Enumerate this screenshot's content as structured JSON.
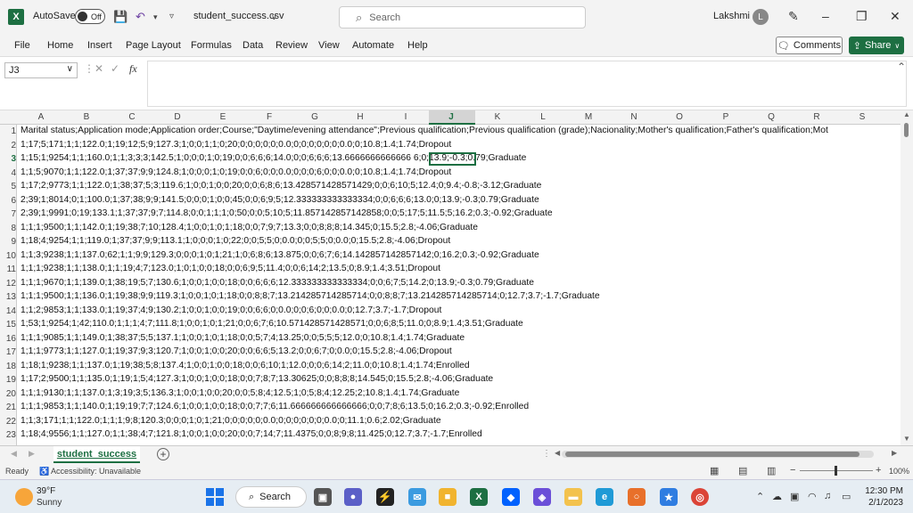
{
  "title_bar": {
    "autosave_label": "AutoSave",
    "autosave_state": "Off",
    "filename": "student_success.csv",
    "search_placeholder": "Search",
    "user_name": "Lakshmi",
    "user_initial": "L"
  },
  "ribbon": {
    "tabs": [
      "File",
      "Home",
      "Insert",
      "Page Layout",
      "Formulas",
      "Data",
      "Review",
      "View",
      "Automate",
      "Help"
    ],
    "comments_label": "Comments",
    "share_label": "Share"
  },
  "formula_bar": {
    "name_box": "J3",
    "formula": ""
  },
  "columns": [
    "A",
    "B",
    "C",
    "D",
    "E",
    "F",
    "G",
    "H",
    "I",
    "J",
    "K",
    "L",
    "M",
    "N",
    "O",
    "P",
    "Q",
    "R",
    "S"
  ],
  "selected_column": "J",
  "rows": [
    {
      "n": "1",
      "text": "Marital status;Application mode;Application order;Course;\"Daytime/evening attendance\";Previous qualification;Previous qualification (grade);Nacionality;Mother's qualification;Father's qualification;Mot"
    },
    {
      "n": "2",
      "text": "1;17;5;171;1;1;122.0;1;19;12;5;9;127.3;1;0;0;1;1;0;20;0;0;0;0;0;0.0;0;0;0;0;0;0;0.0;0;10.8;1.4;1.74;Dropout"
    },
    {
      "n": "3",
      "text": "1;15;1;9254;1;1;160.0;1;1;3;3;3;142.5;1;0;0;0;1;0;19;0;0;6;6;6;14.0;0;0;6;6;6;13.6666666666666 6;0;13.9;-0.3;0.79;Graduate"
    },
    {
      "n": "4",
      "text": "1;1;5;9070;1;1;122.0;1;37;37;9;9;124.8;1;0;0;0;1;0;19;0;0;6;0;0;0.0;0;0;0;6;0;0;0.0;0;10.8;1.4;1.74;Dropout"
    },
    {
      "n": "5",
      "text": "1;17;2;9773;1;1;122.0;1;38;37;5;3;119.6;1;0;0;1;0;0;20;0;0;6;8;6;13.428571428571429;0;0;6;10;5;12.4;0;9.4;-0.8;-3.12;Graduate"
    },
    {
      "n": "6",
      "text": "2;39;1;8014;0;1;100.0;1;37;38;9;9;141.5;0;0;0;1;0;0;45;0;0;6;9;5;12.333333333333334;0;0;6;6;6;13.0;0;13.9;-0.3;0.79;Graduate"
    },
    {
      "n": "7",
      "text": "2;39;1;9991;0;19;133.1;1;37;37;9;7;114.8;0;0;1;1;1;0;50;0;0;5;10;5;11.857142857142858;0;0;5;17;5;11.5;5;16.2;0.3;-0.92;Graduate"
    },
    {
      "n": "8",
      "text": "1;1;1;9500;1;1;142.0;1;19;38;7;10;128.4;1;0;0;1;0;1;18;0;0;7;9;7;13.3;0;0;8;8;8;14.345;0;15.5;2.8;-4.06;Graduate"
    },
    {
      "n": "9",
      "text": "1;18;4;9254;1;1;119.0;1;37;37;9;9;113.1;1;0;0;0;1;0;22;0;0;5;5;0;0.0;0;0;5;5;0;0.0;0;15.5;2.8;-4.06;Dropout"
    },
    {
      "n": "10",
      "text": "1;1;3;9238;1;1;137.0;62;1;1;9;9;129.3;0;0;0;1;0;1;21;1;0;6;8;6;13.875;0;0;6;7;6;14.142857142857142;0;16.2;0.3;-0.92;Graduate"
    },
    {
      "n": "11",
      "text": "1;1;1;9238;1;1;138.0;1;1;19;4;7;123.0;1;0;1;0;0;18;0;0;6;9;5;11.4;0;0;6;14;2;13.5;0;8.9;1.4;3.51;Dropout"
    },
    {
      "n": "12",
      "text": "1;1;1;9670;1;1;139.0;1;38;19;5;7;130.6;1;0;0;1;0;0;18;0;0;6;6;6;12.333333333333334;0;0;6;7;5;14.2;0;13.9;-0.3;0.79;Graduate"
    },
    {
      "n": "13",
      "text": "1;1;1;9500;1;1;136.0;1;19;38;9;9;119.3;1;0;0;1;0;1;18;0;0;8;8;7;13.214285714285714;0;0;8;8;7;13.214285714285714;0;12.7;3.7;-1.7;Graduate"
    },
    {
      "n": "14",
      "text": "1;1;2;9853;1;1;133.0;1;19;37;4;9;130.2;1;0;0;1;0;0;19;0;0;6;6;0;0.0;0;0;6;0;0;0.0;0;12.7;3.7;-1.7;Dropout"
    },
    {
      "n": "15",
      "text": "1;53;1;9254;1;42;110.0;1;1;1;4;7;111.8;1;0;0;1;0;1;21;0;0;6;7;6;10.571428571428571;0;0;6;8;5;11.0;0;8.9;1.4;3.51;Graduate"
    },
    {
      "n": "16",
      "text": "1;1;1;9085;1;1;149.0;1;38;37;5;5;137.1;1;0;0;1;0;1;18;0;0;5;7;4;13.25;0;0;5;5;5;12.0;0;10.8;1.4;1.74;Graduate"
    },
    {
      "n": "17",
      "text": "1;1;1;9773;1;1;127.0;1;19;37;9;3;120.7;1;0;0;1;0;0;20;0;0;6;6;5;13.2;0;0;6;7;0;0.0;0;15.5;2.8;-4.06;Dropout"
    },
    {
      "n": "18",
      "text": "1;18;1;9238;1;1;137.0;1;19;38;5;8;137.4;1;0;0;1;0;0;18;0;0;6;10;1;12.0;0;0;6;14;2;11.0;0;10.8;1.4;1.74;Enrolled"
    },
    {
      "n": "19",
      "text": "1;17;2;9500;1;1;135.0;1;19;1;5;4;127.3;1;0;0;1;0;0;18;0;0;7;8;7;13.30625;0;0;8;8;8;14.545;0;15.5;2.8;-4.06;Graduate"
    },
    {
      "n": "20",
      "text": "1;1;1;9130;1;1;137.0;1;3;19;3;5;136.3;1;0;0;1;0;0;20;0;0;5;8;4;12.5;1;0;5;8;4;12.25;2;10.8;1.4;1.74;Graduate"
    },
    {
      "n": "21",
      "text": "1;1;1;9853;1;1;140.0;1;19;19;7;7;124.6;1;0;0;1;0;0;18;0;0;7;7;6;11.666666666666666;0;0;7;8;6;13.5;0;16.2;0.3;-0.92;Enrolled"
    },
    {
      "n": "22",
      "text": "1;1;3;171;1;1;122.0;1;1;1;9;8;120.3;0;0;0;1;0;1;21;0;0;0;0;0;0.0;0;0;0;0;0;0;0.0;0;11.1;0.6;2.02;Graduate"
    },
    {
      "n": "23",
      "text": "1;18;4;9556;1;1;127.0;1;1;38;4;7;121.8;1;0;0;1;0;0;20;0;0;7;14;7;11.4375;0;0;8;9;8;11.425;0;12.7;3.7;-1.7;Enrolled"
    }
  ],
  "sheet": {
    "tab_name": "student_success"
  },
  "status": {
    "ready": "Ready",
    "accessibility": "Accessibility: Unavailable",
    "zoom": "100%"
  },
  "taskbar": {
    "temp": "39°F",
    "weather": "Sunny",
    "search": "Search",
    "time": "12:30 PM",
    "date": "2/1/2023"
  }
}
